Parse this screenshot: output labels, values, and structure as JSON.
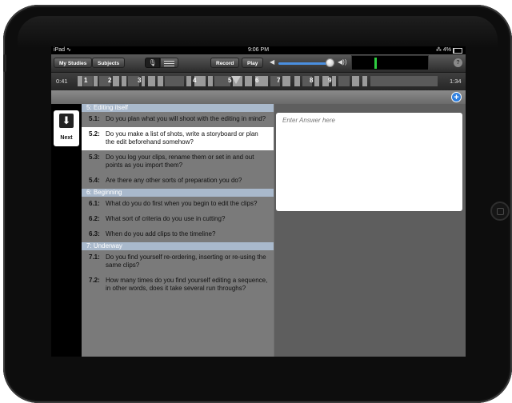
{
  "status_bar": {
    "device_label": "iPad",
    "wifi_icon": "wifi-icon",
    "time": "9:06 PM",
    "battery_text": "4%",
    "bluetooth_icon": "bluetooth-icon"
  },
  "toolbar": {
    "my_studies_label": "My Studies",
    "subjects_label": "Subjects",
    "mic_icon": "microphone-icon",
    "list_icon": "list-icon",
    "record_label": "Record",
    "play_label": "Play",
    "volume_low_icon": "speaker-low-icon",
    "volume_high_icon": "speaker-high-icon",
    "volume_level": 0.85,
    "help_label": "?",
    "accent_color": "#4a8fe0",
    "level_color": "#2ecc40"
  },
  "timeline": {
    "start_time": "0:41",
    "end_time": "1:34",
    "markers": [
      "1",
      "2",
      "3",
      "4",
      "5",
      "6",
      "7",
      "8",
      "9"
    ],
    "current_marker": "5"
  },
  "subbar": {
    "add_label": "+"
  },
  "next_button": {
    "label": "Next",
    "arrow": "⬇"
  },
  "sections": [
    {
      "header": "5: Editing itself",
      "questions": [
        {
          "num": "5.1:",
          "text": "Do you plan what you will shoot with the editing in mind?",
          "selected": false
        },
        {
          "num": "5.2:",
          "text": "Do you make a list of shots, write a storyboard or plan the edit beforehand somehow?",
          "selected": true
        },
        {
          "num": "5.3:",
          "text": "Do you log your clips, rename them or set in and out points as you import them?",
          "selected": false
        },
        {
          "num": "5.4:",
          "text": "Are there any other sorts of preparation you do?",
          "selected": false
        }
      ]
    },
    {
      "header": "6: Beginning",
      "questions": [
        {
          "num": "6.1:",
          "text": "What do you do first when you begin to edit the clips?",
          "selected": false
        },
        {
          "num": "6.2:",
          "text": "What sort of criteria do you use in cutting?",
          "selected": false
        },
        {
          "num": "6.3:",
          "text": "When do you add clips to the timeline?",
          "selected": false
        }
      ]
    },
    {
      "header": "7: Underway",
      "questions": [
        {
          "num": "7.1:",
          "text": "Do you find yourself re-ordering, inserting or re-using the same clips?",
          "selected": false
        },
        {
          "num": "7.2:",
          "text": "How many times do you find yourself editing a sequence, in other words, does it take several run throughs?",
          "selected": false
        }
      ]
    }
  ],
  "answer": {
    "placeholder": "Enter Answer here",
    "value": ""
  }
}
